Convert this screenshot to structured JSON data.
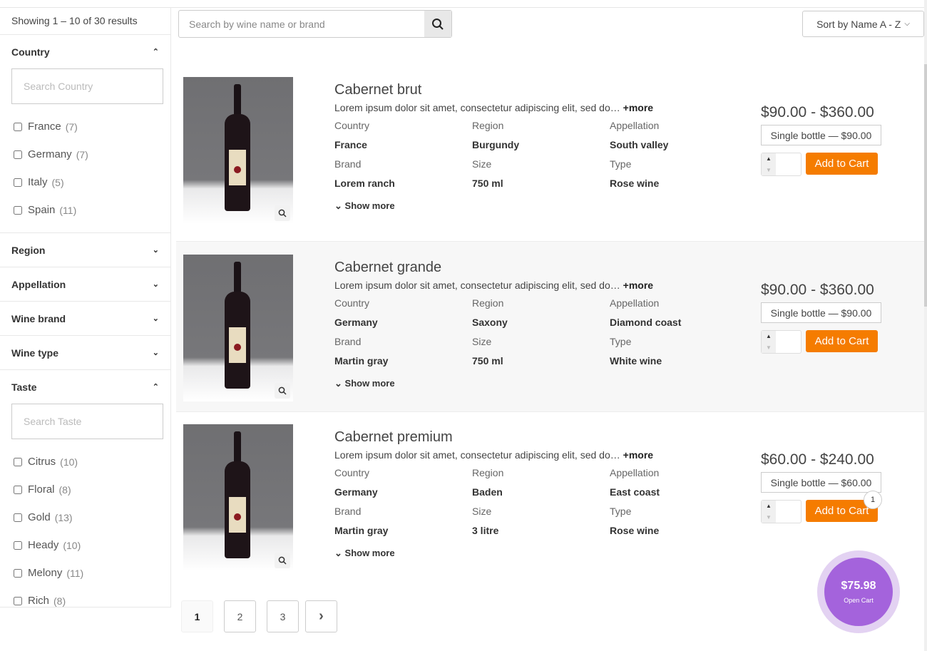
{
  "results": "Showing 1 – 10 of 30 results",
  "search": {
    "placeholder": "Search by wine name or brand"
  },
  "sort": {
    "label": "Sort by Name A - Z"
  },
  "filters": {
    "country": {
      "title": "Country",
      "search": "Search Country",
      "items": [
        {
          "label": "France",
          "count": "(7)"
        },
        {
          "label": "Germany",
          "count": "(7)"
        },
        {
          "label": "Italy",
          "count": "(5)"
        },
        {
          "label": "Spain",
          "count": "(11)"
        }
      ]
    },
    "collapsed": [
      "Region",
      "Appellation",
      "Wine brand",
      "Wine type"
    ],
    "taste": {
      "title": "Taste",
      "search": "Search Taste",
      "items": [
        {
          "label": "Citrus",
          "count": "(10)"
        },
        {
          "label": "Floral",
          "count": "(8)"
        },
        {
          "label": "Gold",
          "count": "(13)"
        },
        {
          "label": "Heady",
          "count": "(10)"
        },
        {
          "label": "Melony",
          "count": "(11)"
        },
        {
          "label": "Rich",
          "count": "(8)"
        }
      ]
    }
  },
  "labels": {
    "country": "Country",
    "region": "Region",
    "appellation": "Appellation",
    "brand": "Brand",
    "size": "Size",
    "type": "Type",
    "more": "+more",
    "show_more": "Show more",
    "add": "Add to Cart"
  },
  "products": [
    {
      "name": "Cabernet brut",
      "desc": "Lorem ipsum dolor sit amet, consectetur adipiscing elit, sed do…",
      "country": "France",
      "region": "Burgundy",
      "appellation": "South valley",
      "brand": "Lorem ranch",
      "size": "750 ml",
      "type": "Rose wine",
      "price": "$90.00 - $360.00",
      "variant": "Single bottle — $90.00"
    },
    {
      "name": "Cabernet grande",
      "desc": "Lorem ipsum dolor sit amet, consectetur adipiscing elit, sed do…",
      "country": "Germany",
      "region": "Saxony",
      "appellation": "Diamond coast",
      "brand": "Martin gray",
      "size": "750 ml",
      "type": "White wine",
      "price": "$90.00 - $360.00",
      "variant": "Single bottle — $90.00"
    },
    {
      "name": "Cabernet premium",
      "desc": "Lorem ipsum dolor sit amet, consectetur adipiscing elit, sed do…",
      "country": "Germany",
      "region": "Baden",
      "appellation": "East coast",
      "brand": "Martin gray",
      "size": "3 litre",
      "type": "Rose wine",
      "price": "$60.00 - $240.00",
      "variant": "Single bottle — $60.00",
      "badge": "1"
    }
  ],
  "pagination": [
    "1",
    "2",
    "3"
  ],
  "cart": {
    "amount": "$75.98",
    "label": "Open Cart"
  }
}
